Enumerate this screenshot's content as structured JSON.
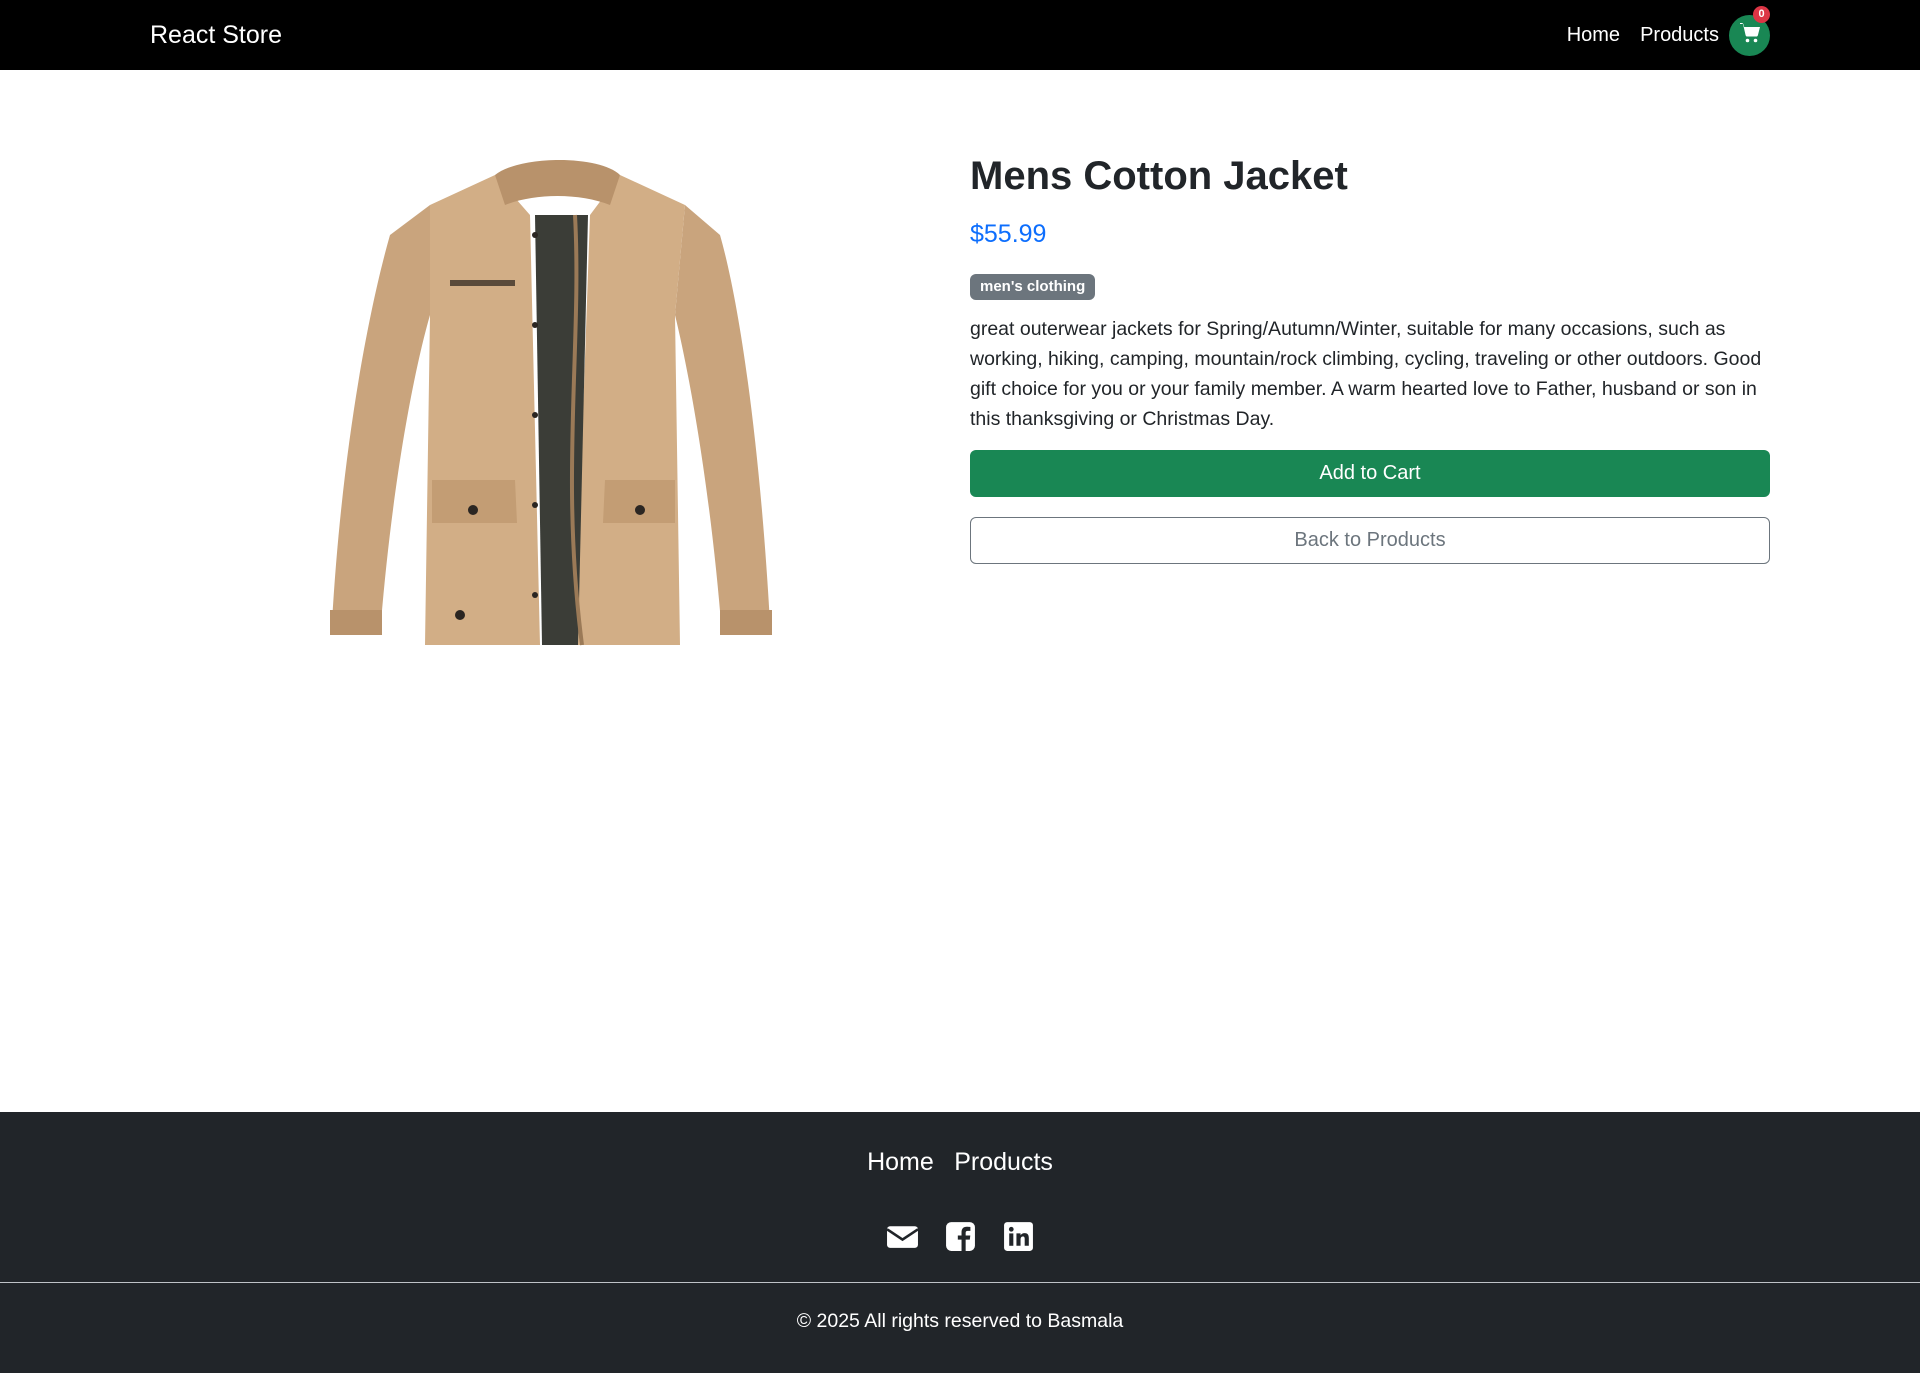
{
  "navbar": {
    "brand": "React Store",
    "links": [
      "Home",
      "Products"
    ],
    "cart_count": "0",
    "cart_icon": "shopping-cart-icon"
  },
  "product": {
    "title": "Mens Cotton Jacket",
    "price": "$55.99",
    "category": "men's clothing",
    "description": "great outerwear jackets for Spring/Autumn/Winter, suitable for many occasions, such as working, hiking, camping, mountain/rock climbing, cycling, traveling or other outdoors. Good gift choice for you or your family member. A warm hearted love to Father, husband or son in this thanksgiving or Christmas Day.",
    "add_to_cart_label": "Add to Cart",
    "back_label": "Back to Products",
    "image_alt": "Mens Cotton Jacket"
  },
  "footer": {
    "links": [
      "Home",
      "Products"
    ],
    "social_icons": [
      "envelope-icon",
      "facebook-icon",
      "linkedin-icon"
    ],
    "copyright": "© 2025 All rights reserved to Basmala"
  },
  "colors": {
    "navbar": "#000000",
    "footer": "#212529",
    "success": "#198754",
    "price": "#0d6efd",
    "badge": "#6c757d",
    "cart_badge": "#dc3545"
  }
}
